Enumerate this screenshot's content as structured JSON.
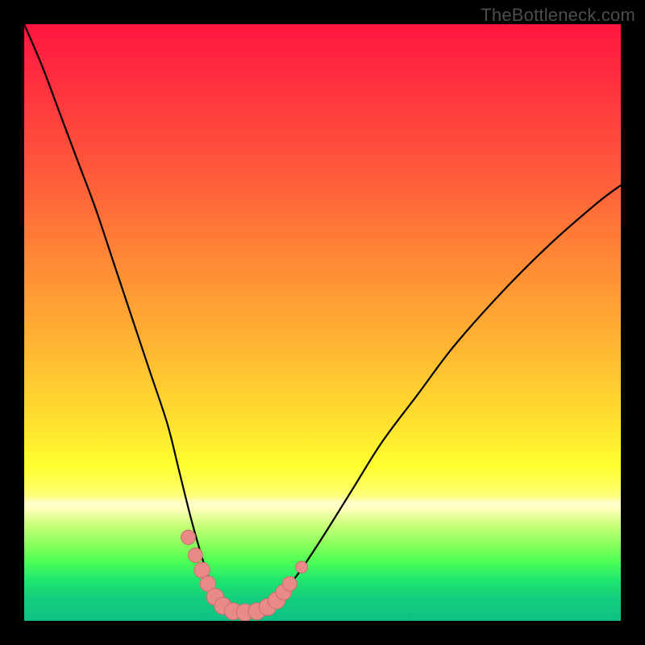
{
  "watermark": "TheBottleneck.com",
  "colors": {
    "frame": "#000000",
    "curve": "#000000",
    "marker_fill": "#e88a88",
    "marker_stroke": "#c96d6b"
  },
  "chart_data": {
    "type": "line",
    "title": "",
    "xlabel": "",
    "ylabel": "",
    "xlim": [
      0,
      100
    ],
    "ylim": [
      0,
      100
    ],
    "grid": false,
    "legend": false,
    "background": "rainbow-gradient (red→orange→yellow→green, top to bottom)",
    "series": [
      {
        "name": "left-arm",
        "x": [
          0,
          3,
          6,
          9,
          12,
          15,
          18,
          21,
          24,
          26,
          28,
          30,
          32
        ],
        "y": [
          100,
          93,
          85,
          77,
          69,
          60,
          51,
          42,
          33,
          25,
          17,
          10,
          4
        ]
      },
      {
        "name": "valley-floor",
        "x": [
          32,
          34,
          36,
          38,
          40,
          42
        ],
        "y": [
          4,
          2,
          1.5,
          1.5,
          2,
          3
        ]
      },
      {
        "name": "right-arm",
        "x": [
          42,
          46,
          50,
          55,
          60,
          66,
          72,
          80,
          88,
          96,
          100
        ],
        "y": [
          3,
          8,
          14,
          22,
          30,
          38,
          46,
          55,
          63,
          70,
          73
        ]
      }
    ],
    "markers": {
      "name": "highlight-points",
      "note": "salmon-colored rounded dots clustered near the valley/minimum",
      "points": [
        {
          "x": 27.5,
          "y": 14,
          "r": 2.2
        },
        {
          "x": 28.7,
          "y": 11,
          "r": 2.2
        },
        {
          "x": 29.8,
          "y": 8.5,
          "r": 2.4
        },
        {
          "x": 30.8,
          "y": 6.2,
          "r": 2.4
        },
        {
          "x": 32.0,
          "y": 4.0,
          "r": 2.6
        },
        {
          "x": 33.3,
          "y": 2.5,
          "r": 2.6
        },
        {
          "x": 35.0,
          "y": 1.6,
          "r": 2.6
        },
        {
          "x": 37.0,
          "y": 1.4,
          "r": 2.6
        },
        {
          "x": 39.0,
          "y": 1.6,
          "r": 2.6
        },
        {
          "x": 40.8,
          "y": 2.3,
          "r": 2.6
        },
        {
          "x": 42.3,
          "y": 3.4,
          "r": 2.6
        },
        {
          "x": 43.5,
          "y": 4.8,
          "r": 2.4
        },
        {
          "x": 44.5,
          "y": 6.2,
          "r": 2.2
        },
        {
          "x": 46.5,
          "y": 9.0,
          "r": 1.8
        }
      ]
    }
  }
}
